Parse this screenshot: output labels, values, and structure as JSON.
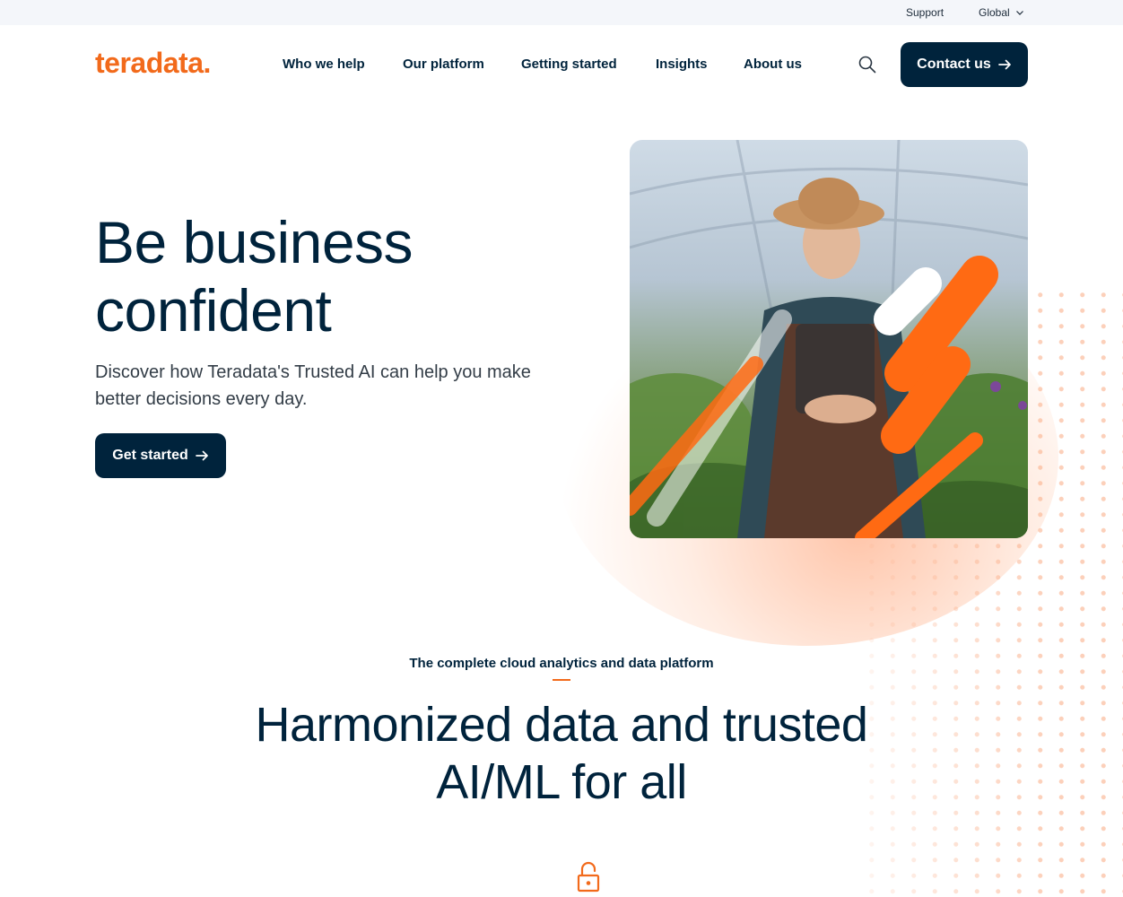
{
  "utility_bar": {
    "support_label": "Support",
    "region_label": "Global"
  },
  "nav": {
    "logo_text": "teradata.",
    "items": [
      {
        "label": "Who we help"
      },
      {
        "label": "Our platform"
      },
      {
        "label": "Getting started"
      },
      {
        "label": "Insights"
      },
      {
        "label": "About us"
      }
    ],
    "search_icon": "search-icon",
    "contact_label": "Contact us"
  },
  "hero": {
    "title_line1": "Be business",
    "title_line2": "confident",
    "subtitle": "Discover how Teradata's Trusted AI can help you make better decisions every day.",
    "cta_label": "Get started",
    "image_alt": "Woman in straw hat and apron holding a tablet in a greenhouse"
  },
  "platform_section": {
    "eyebrow": "The complete cloud analytics and data platform",
    "title_line1": "Harmonized data and trusted",
    "title_line2": "AI/ML for all",
    "icon": "unlock-icon"
  },
  "colors": {
    "brand_orange": "#f26a1b",
    "navy": "#00233c",
    "utility_bg": "#f4f6fa"
  }
}
